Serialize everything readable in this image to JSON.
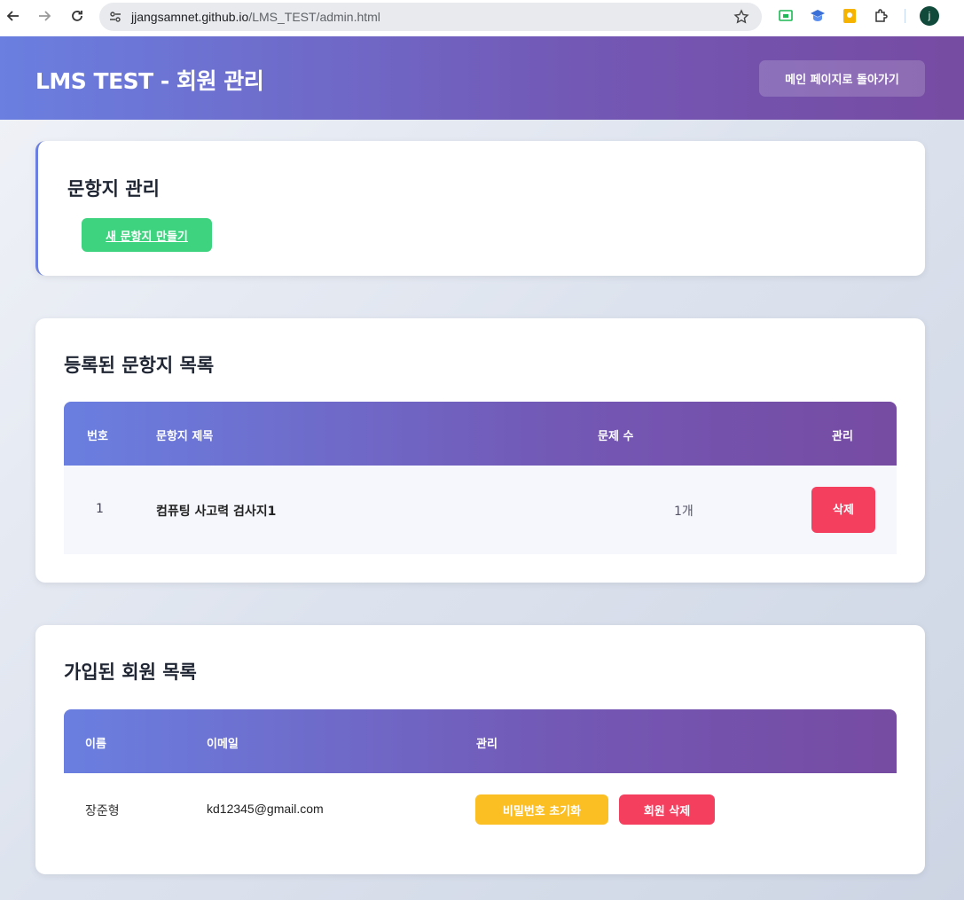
{
  "browser": {
    "url_host": "jjangsamnet.github.io",
    "url_path": "/LMS_TEST/admin.html",
    "profile_initial": "j"
  },
  "header": {
    "title": "LMS TEST - 회원 관리",
    "back_button": "메인 페이지로 돌아가기"
  },
  "questionnaire_admin": {
    "title": "문항지 관리",
    "new_button": "새 문항지 만들기"
  },
  "questionnaire_list": {
    "title": "등록된 문항지 목록",
    "columns": [
      "번호",
      "문항지 제목",
      "문제 수",
      "관리"
    ],
    "rows": [
      {
        "number": "1",
        "title": "컴퓨팅 사고력 검사지1",
        "count": "1개",
        "action": "삭제"
      }
    ]
  },
  "member_list": {
    "title": "가입된 회원 목록",
    "columns": [
      "이름",
      "이메일",
      "관리"
    ],
    "rows": [
      {
        "name": "장준형",
        "email": "kd12345@gmail.com",
        "reset": "비밀번호 초기화",
        "delete": "회원 삭제"
      }
    ]
  },
  "colors": {
    "header_gradient_start": "#6a7fe0",
    "header_gradient_end": "#764ba2",
    "green": "#3ed47f",
    "danger": "#f43f5e",
    "warning": "#fbbf24"
  }
}
